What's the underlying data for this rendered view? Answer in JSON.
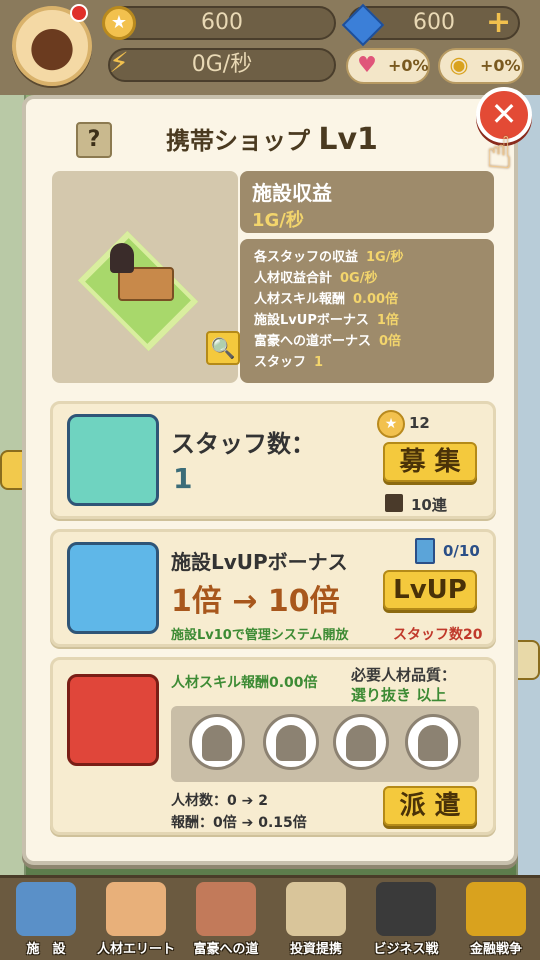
{
  "hud": {
    "coins": "600",
    "gems": "600",
    "gem_plus": "+",
    "income_rate": "0G/秒",
    "heart_boost": "+0%",
    "coin_boost": "+0%"
  },
  "modal": {
    "help": "?",
    "title": "携帯ショップ",
    "level": "Lv1",
    "close": "✕",
    "income_title": "施設収益",
    "income_value": "1G/秒",
    "stats": [
      {
        "label": "各スタッフの収益",
        "value": "1G/秒"
      },
      {
        "label": "人材収益合計",
        "value": "0G/秒"
      },
      {
        "label": "人材スキル報酬",
        "value": "0.00倍"
      },
      {
        "label": "施設LvUPボーナス",
        "value": "1倍"
      },
      {
        "label": "富豪への道ボーナス",
        "value": "0倍"
      },
      {
        "label": "スタッフ",
        "value": "1"
      }
    ]
  },
  "staff_card": {
    "label": "スタッフ数：",
    "value": "1",
    "cost": "12",
    "recruit_button": "募 集",
    "bulk_label": "10連"
  },
  "bonus_card": {
    "title": "施設LvUPボーナス",
    "value": "1倍 → 10倍",
    "note": "施設Lv10で管理システム開放",
    "count": "0/10",
    "button": "LvUP",
    "requirement": "スタッフ数20"
  },
  "dispatch_card": {
    "skill": "人材スキル報酬0.00倍",
    "req_line1": "必要人材品質：",
    "req_line2": "選り抜き 以上",
    "people": "人材数：0 ➔ 2",
    "reward": "報酬：0倍 ➔ 0.15倍",
    "button": "派 遣"
  },
  "nav": [
    {
      "label": "施　設",
      "icon": "building-icon"
    },
    {
      "label": "人材エリート",
      "icon": "staff-icon"
    },
    {
      "label": "富豪への道",
      "icon": "road-icon"
    },
    {
      "label": "投資提携",
      "icon": "handshake-icon"
    },
    {
      "label": "ビジネス戦",
      "icon": "business-icon"
    },
    {
      "label": "金融戦争",
      "icon": "finance-icon"
    }
  ],
  "colors": {
    "accent_gold": "#f4c93d",
    "panel_brown": "#9e8b6b",
    "card_bg": "#f7ecd0",
    "close_red": "#e34a35"
  }
}
